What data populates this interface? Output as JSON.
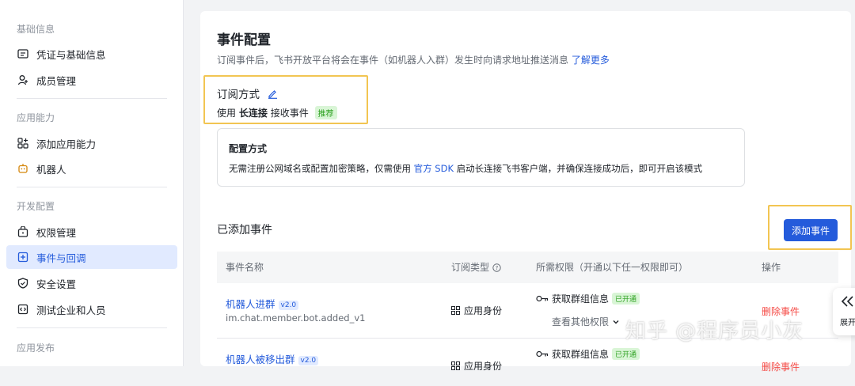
{
  "sidebar": {
    "sections": [
      {
        "title": "基础信息",
        "items": [
          {
            "label": "凭证与基础信息",
            "icon": "credential-icon"
          },
          {
            "label": "成员管理",
            "icon": "member-add-icon"
          }
        ]
      },
      {
        "title": "应用能力",
        "items": [
          {
            "label": "添加应用能力",
            "icon": "add-capability-icon"
          },
          {
            "label": "机器人",
            "icon": "robot-icon"
          }
        ]
      },
      {
        "title": "开发配置",
        "items": [
          {
            "label": "权限管理",
            "icon": "permission-icon"
          },
          {
            "label": "事件与回调",
            "icon": "event-icon",
            "active": true
          },
          {
            "label": "安全设置",
            "icon": "shield-icon"
          },
          {
            "label": "测试企业和人员",
            "icon": "test-icon"
          }
        ]
      },
      {
        "title": "应用发布",
        "items": []
      }
    ]
  },
  "main": {
    "title": "事件配置",
    "description": "订阅事件后，飞书开放平台将会在事件（如机器人入群）发生时向请求地址推送消息",
    "learn_more": "了解更多",
    "subscription": {
      "label": "订阅方式",
      "prefix": "使用",
      "mode": "长连接",
      "suffix": "接收事件",
      "badge": "推荐"
    },
    "config": {
      "title": "配置方式",
      "text_before": "无需注册公网域名或配置加密策略，仅需使用",
      "sdk_link": "官方 SDK",
      "text_after": "启动长连接飞书客户端，并确保连接成功后，即可开启该模式"
    },
    "added_events_title": "已添加事件",
    "add_event_button": "添加事件",
    "table": {
      "headers": {
        "name": "事件名称",
        "type": "订阅类型",
        "permissions": "所需权限（开通以下任一权限即可）",
        "actions": "操作"
      },
      "rows": [
        {
          "name": "机器人进群",
          "version": "v2.0",
          "code": "im.chat.member.bot.added_v1",
          "type": "应用身份",
          "permission": "获取群组信息",
          "perm_status": "已开通",
          "more": "查看其他权限",
          "action": "删除事件"
        },
        {
          "name": "机器人被移出群",
          "version": "v2.0",
          "code": "",
          "type": "应用身份",
          "permission": "获取群组信息",
          "perm_status": "已开通",
          "more": "",
          "action": "删除事件"
        }
      ]
    }
  },
  "expand_label": "展开",
  "watermark": "知乎 @程序员小灰",
  "colors": {
    "accent": "#245bdb",
    "highlight": "#f2c552",
    "danger": "#f54a45",
    "success": "#2ea121"
  }
}
